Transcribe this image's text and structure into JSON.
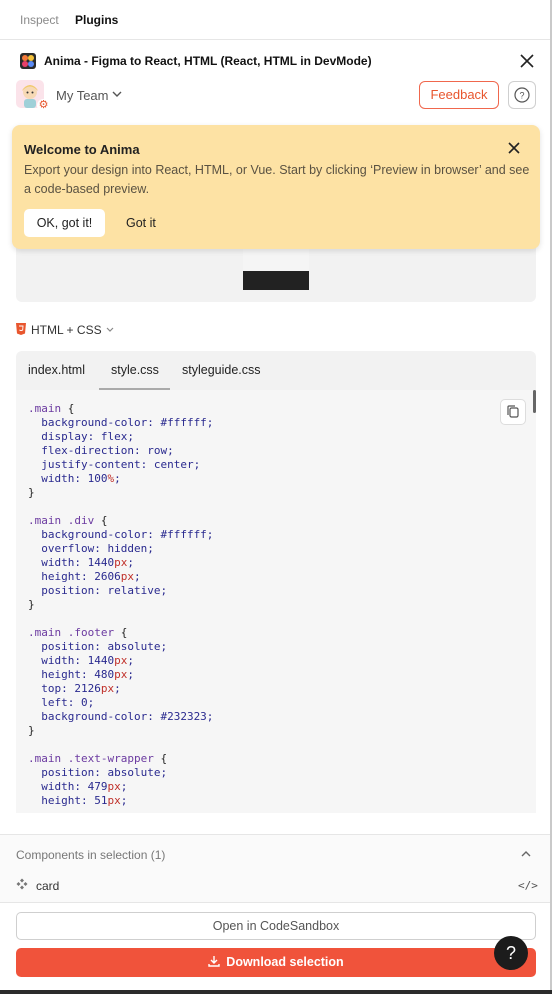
{
  "topbar": {
    "tabs": [
      "Inspect",
      "Plugins"
    ],
    "active_tab": "Plugins"
  },
  "titlebar": {
    "title": "Anima - Figma to React, HTML (React, HTML in DevMode)",
    "logo_icon": "anima-logo",
    "close_icon": "close-icon"
  },
  "team": {
    "label": "My Team",
    "avatar_icon": "avatar",
    "settings_icon": "gear-icon",
    "feedback_label": "Feedback",
    "help_label": "?"
  },
  "banner": {
    "title": "Welcome to Anima",
    "text": "Export your design into React, HTML, or Vue. Start by clicking ‘Preview in browser’ and see a code-based preview.",
    "ok_label": "OK, got it!",
    "got_label": "Got it",
    "background": "#fde2a4"
  },
  "language": {
    "label": "HTML + CSS",
    "icon": "html5-icon"
  },
  "code": {
    "tabs": [
      "index.html",
      "style.css",
      "styleguide.css"
    ],
    "active_tab": "style.css"
  },
  "components": {
    "title": "Components in selection (1)",
    "items": [
      {
        "label": "card",
        "icon": "component-icon"
      }
    ]
  },
  "footer": {
    "open_label": "Open in CodeSandbox",
    "download_label": "Download selection",
    "help_label": "?"
  },
  "colors": {
    "accent": "#f0533b",
    "banner": "#fde2a4"
  }
}
